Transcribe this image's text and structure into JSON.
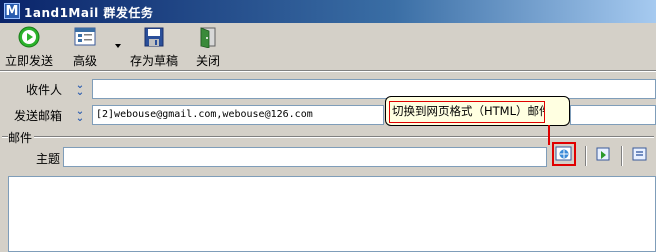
{
  "window": {
    "title": "1and1Mail 群发任务",
    "icon_letter": "M"
  },
  "toolbar": {
    "send_now": "立即发送",
    "advanced": "高级",
    "save_draft": "存为草稿",
    "close": "关闭"
  },
  "fields": {
    "recipients_label": "收件人",
    "recipients_value": "",
    "sender_label": "发送邮箱",
    "sender_value": "[2]webouse@gmail.com,webouse@126.com"
  },
  "mail": {
    "group_label": "邮件",
    "subject_label": "主题",
    "subject_value": "",
    "body": ""
  },
  "tooltip": {
    "text": "切换到网页格式（HTML）邮件"
  },
  "colors": {
    "accent": "#0a246a",
    "highlight": "#e00000",
    "tooltip_bg": "#ffffe1"
  },
  "icons": [
    "play-icon",
    "advanced-settings-icon",
    "save-disk-icon",
    "close-door-icon",
    "html-format-icon",
    "import-icon",
    "export-icon"
  ]
}
